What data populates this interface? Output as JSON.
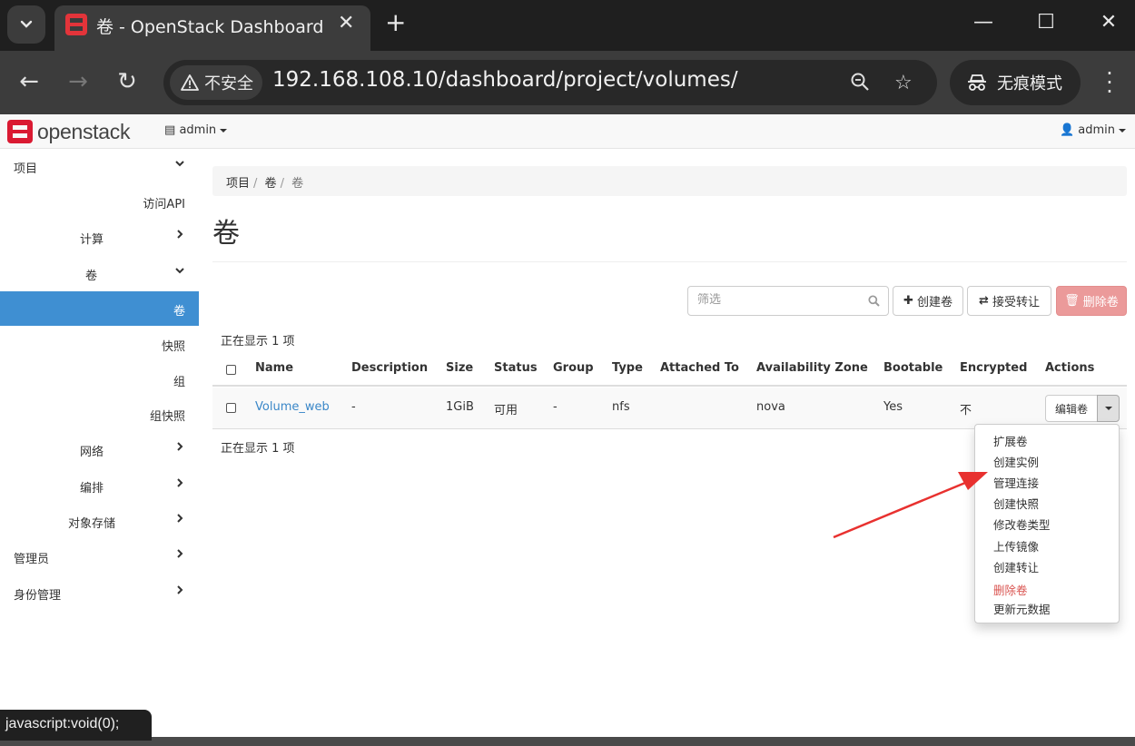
{
  "browser": {
    "tab_title": "卷 - OpenStack Dashboard",
    "security_label": "不安全",
    "url": "192.168.108.10/dashboard/project/volumes/",
    "incognito_label": "无痕模式"
  },
  "navbar": {
    "logo_text": "openstack",
    "project": "admin",
    "user": "admin"
  },
  "sidebar": {
    "project": "项目",
    "api_access": "访问API",
    "compute": "计算",
    "volumes_group": "卷",
    "volumes": "卷",
    "snapshots": "快照",
    "groups": "组",
    "group_snapshots": "组快照",
    "network": "网络",
    "orchestration": "编排",
    "object_store": "对象存储",
    "admin": "管理员",
    "identity": "身份管理"
  },
  "breadcrumb": [
    "项目",
    "卷",
    "卷"
  ],
  "page": {
    "title": "卷",
    "filter_placeholder": "筛选",
    "create_button": "创建卷",
    "accept_transfer_button": "接受转让",
    "delete_button": "删除卷",
    "count_text": "正在显示 1 项"
  },
  "table": {
    "columns": [
      "Name",
      "Description",
      "Size",
      "Status",
      "Group",
      "Type",
      "Attached To",
      "Availability Zone",
      "Bootable",
      "Encrypted",
      "Actions"
    ],
    "rows": [
      {
        "name": "Volume_web",
        "description": "-",
        "size": "1GiB",
        "status": "可用",
        "group": "-",
        "type": "nfs",
        "attached_to": "",
        "availability_zone": "nova",
        "bootable": "Yes",
        "encrypted": "不",
        "action": "编辑卷"
      }
    ]
  },
  "actions_menu": [
    "扩展卷",
    "创建实例",
    "管理连接",
    "创建快照",
    "修改卷类型",
    "上传镜像",
    "创建转让",
    "删除卷",
    "更新元数据"
  ],
  "status_bar": "javascript:void(0);",
  "colors": {
    "accent": "#3f8fd2",
    "danger": "#eb9a9a",
    "link": "#3a87c8",
    "arrow": "#e8312f"
  }
}
